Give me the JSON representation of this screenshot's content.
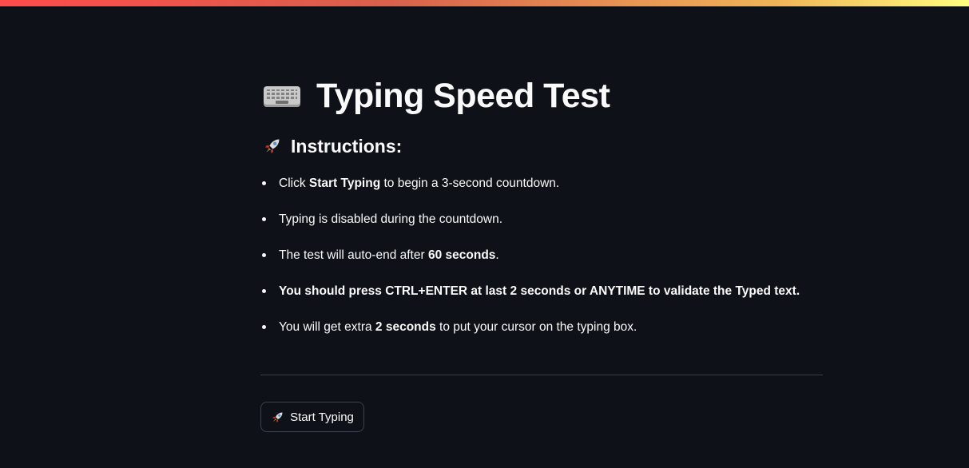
{
  "app": {
    "title": "Typing Speed Test",
    "title_icon": "keyboard-icon",
    "accent_gradient": [
      "#ff4b4b",
      "#fffd80"
    ],
    "background": "#0e1117"
  },
  "instructions": {
    "heading": "Instructions:",
    "heading_icon": "rocket-icon",
    "items": [
      {
        "pre": "Click ",
        "bold": "Start Typing",
        "post": " to begin a 3-second countdown."
      },
      {
        "pre": "Typing is disabled during the countdown.",
        "bold": "",
        "post": ""
      },
      {
        "pre": "The test will auto-end after ",
        "bold": "60 seconds",
        "post": "."
      },
      {
        "pre": "",
        "bold": "You should press CTRL+ENTER at last 2 seconds or ANYTIME to validate the Typed text.",
        "post": ""
      },
      {
        "pre": "You will get extra ",
        "bold": "2 seconds",
        "post": " to put your cursor on the typing box."
      }
    ]
  },
  "actions": {
    "start_label": "Start Typing",
    "start_icon": "rocket-icon"
  }
}
